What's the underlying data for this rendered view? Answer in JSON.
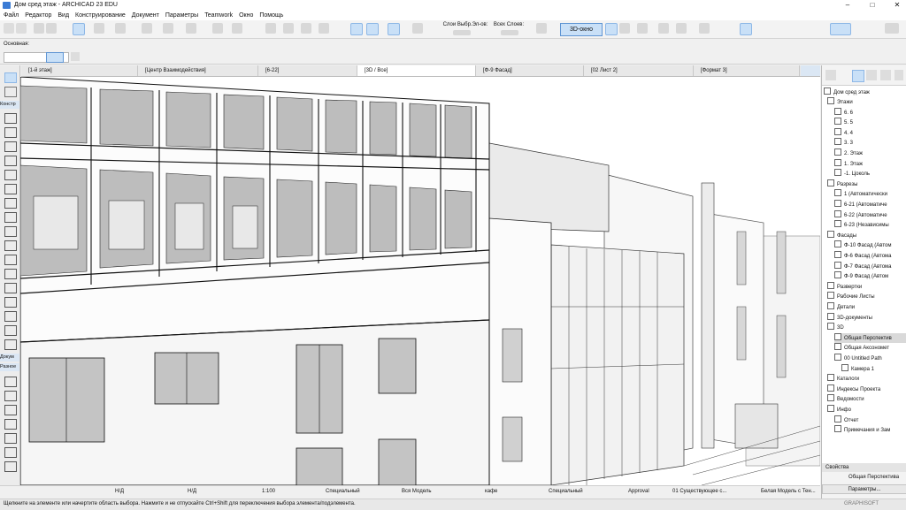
{
  "window": {
    "title": "Дом сред этаж - ARCHICAD 23 EDU",
    "minimize": "–",
    "maximize": "□",
    "close": "✕"
  },
  "menu": [
    "Файл",
    "Редактор",
    "Вид",
    "Конструирование",
    "Документ",
    "Параметры",
    "Teamwork",
    "Окно",
    "Помощь"
  ],
  "toolbar": {
    "layers_label": "Слои Выбр.Эл-ов:",
    "all_layers_label": "Всех Слоев:",
    "view3d_label": "3D-окно"
  },
  "info": {
    "main_label": "Основная:"
  },
  "tabs": [
    "[1-й этаж]",
    "[Центр Взаимодействия]",
    "[6-22]",
    "[3D / Все]",
    "[Ф-9 Фасад]",
    "[02 Лист 2]",
    "[Формат 3]"
  ],
  "toolbox": {
    "construct_label": "Констр",
    "doc_label": "Докум",
    "misc_label": "Разное"
  },
  "navigator": {
    "root": "Дом сред этаж",
    "items": [
      {
        "label": "Этажи",
        "level": 1
      },
      {
        "label": "6. 6",
        "level": 2
      },
      {
        "label": "5. 5",
        "level": 2
      },
      {
        "label": "4. 4",
        "level": 2
      },
      {
        "label": "3. 3",
        "level": 2
      },
      {
        "label": "2. Этаж",
        "level": 2
      },
      {
        "label": "1. Этаж",
        "level": 2
      },
      {
        "label": "-1. Цоколь",
        "level": 2
      },
      {
        "label": "Разрезы",
        "level": 1
      },
      {
        "label": "1 (Автоматически",
        "level": 2
      },
      {
        "label": "6-21 (Автоматиче",
        "level": 2
      },
      {
        "label": "6-22 (Автоматиче",
        "level": 2
      },
      {
        "label": "6-23 (Независимы",
        "level": 2
      },
      {
        "label": "Фасады",
        "level": 1
      },
      {
        "label": "Ф-10 Фасад (Автом",
        "level": 2
      },
      {
        "label": "Ф-6 Фасад (Автома",
        "level": 2
      },
      {
        "label": "Ф-7 Фасад (Автома",
        "level": 2
      },
      {
        "label": "Ф-9 Фасад (Автом",
        "level": 2
      },
      {
        "label": "Развертки",
        "level": 1
      },
      {
        "label": "Рабочие Листы",
        "level": 1
      },
      {
        "label": "Детали",
        "level": 1
      },
      {
        "label": "3D-документы",
        "level": 1
      },
      {
        "label": "3D",
        "level": 1
      },
      {
        "label": "Общая Перспектив",
        "level": 2,
        "selected": true
      },
      {
        "label": "Общая Аксономет",
        "level": 2
      },
      {
        "label": "00 Untitled Path",
        "level": 2
      },
      {
        "label": "Камера 1",
        "level": 3
      },
      {
        "label": "Каталоги",
        "level": 1
      },
      {
        "label": "Индексы Проекта",
        "level": 1
      },
      {
        "label": "Ведомости",
        "level": 1
      },
      {
        "label": "Инфо",
        "level": 1
      },
      {
        "label": "Отчет",
        "level": 2
      },
      {
        "label": "Примечания и Зам",
        "level": 2
      }
    ]
  },
  "properties": {
    "header": "Свойства",
    "view_name": "Общая Перспектива",
    "params_button": "Параметры..."
  },
  "statusbar": {
    "z1": "Н/Д",
    "z2": "Н/Д",
    "scale": "1:100",
    "special1": "Специальный",
    "model": "Вся Модель",
    "cafe": "кафе",
    "special2": "Специальный",
    "approval": "Approval",
    "existing": "01 Существующее с...",
    "whitemodel": "Белая Модель с Тен..."
  },
  "hint": "Щелкните на элементе или начертите область выбора. Нажмите и не отпускайте Ctrl+Shift для переключения выбора элемента/подэлемента.",
  "brand": "GRAPHISOFT",
  "colors": {
    "accent": "#5f95d3",
    "active_tab": "#ffffff",
    "selection": "#d9d9d9"
  }
}
